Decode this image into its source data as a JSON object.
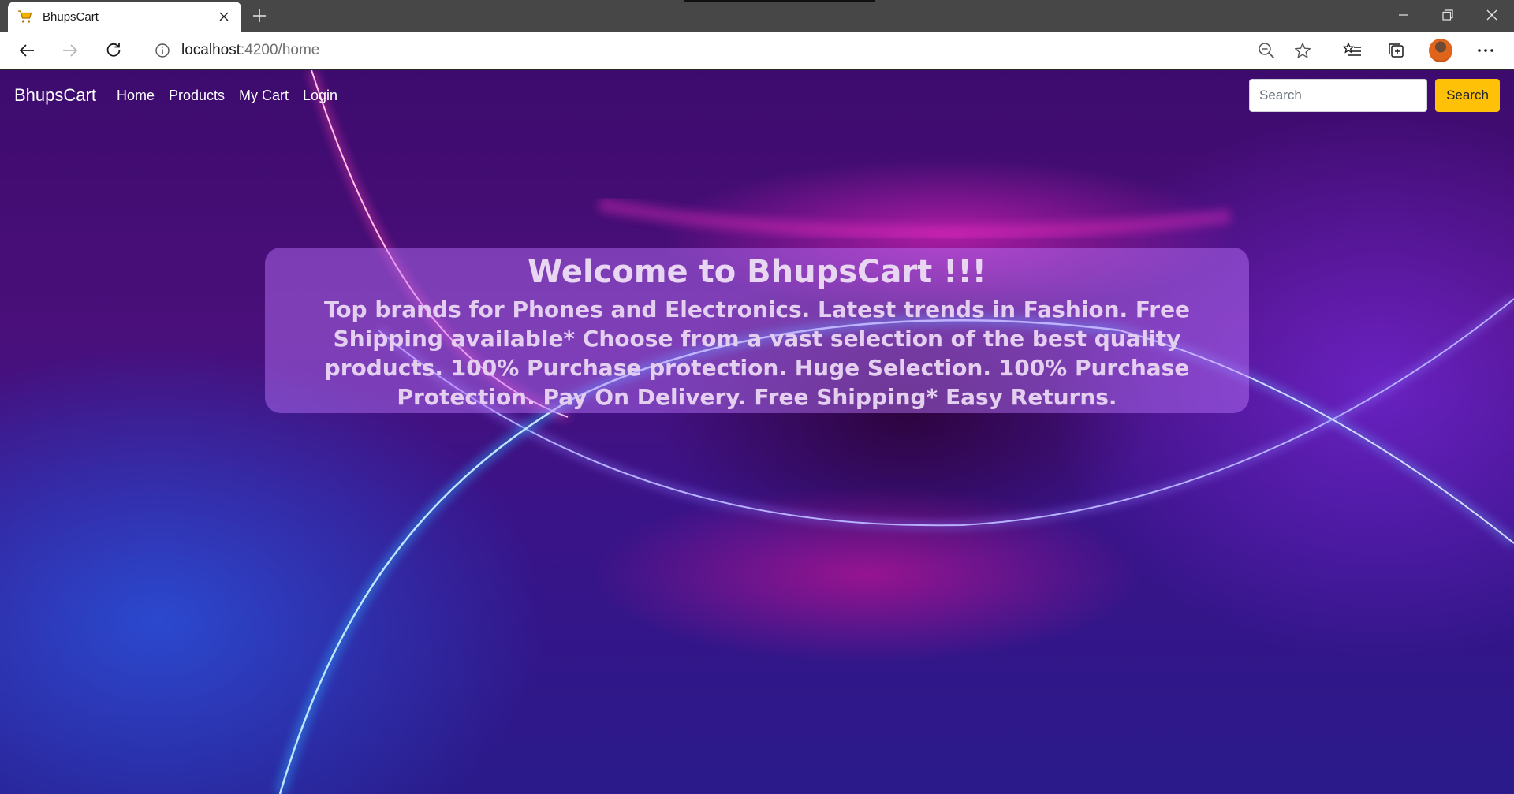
{
  "browser": {
    "tab_title": "BhupsCart",
    "url_host": "localhost",
    "url_path": ":4200/home"
  },
  "navbar": {
    "brand": "BhupsCart",
    "links": [
      "Home",
      "Products",
      "My Cart",
      "Login"
    ],
    "search_placeholder": "Search",
    "search_button": "Search"
  },
  "hero": {
    "heading": "Welcome to BhupsCart !!!",
    "text": "Top brands for Phones and Electronics. Latest trends in Fashion. Free Shipping available* Choose from a vast selection of the best quality products. 100% Purchase protection. Huge Selection. 100% Purchase Protection. Pay On Delivery. Free Shipping* Easy Returns."
  },
  "colors": {
    "search_button": "#ffc107",
    "hero_box": "rgba(190,120,255,0.45)"
  }
}
